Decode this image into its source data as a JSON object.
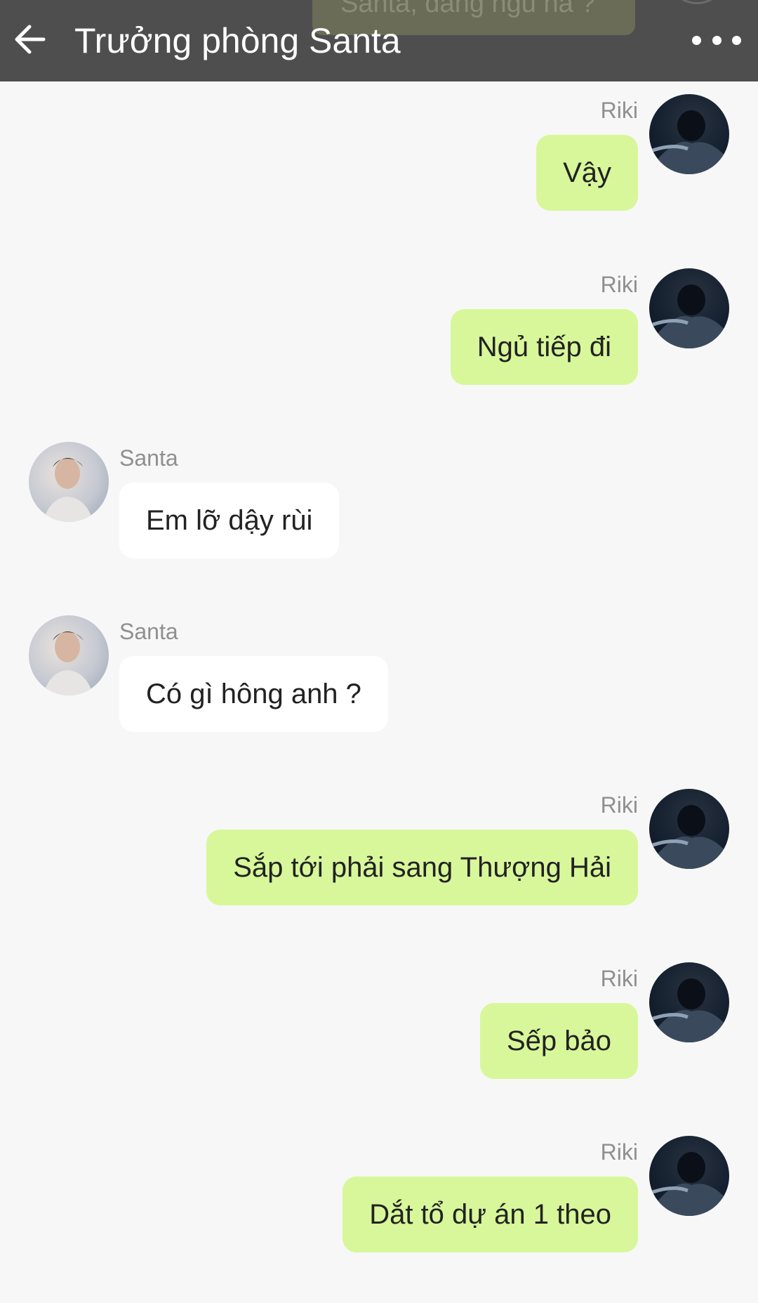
{
  "header": {
    "title": "Trưởng phòng Santa",
    "ghost_message": "Santa, đang ngủ hả ?"
  },
  "messages": [
    {
      "sender": "Riki",
      "side": "right",
      "text": "Vậy"
    },
    {
      "sender": "Riki",
      "side": "right",
      "text": "Ngủ tiếp đi"
    },
    {
      "sender": "Santa",
      "side": "left",
      "text": "Em lỡ dậy rùi"
    },
    {
      "sender": "Santa",
      "side": "left",
      "text": "Có gì hông anh ?"
    },
    {
      "sender": "Riki",
      "side": "right",
      "text": "Sắp tới phải sang Thượng Hải"
    },
    {
      "sender": "Riki",
      "side": "right",
      "text": "Sếp bảo"
    },
    {
      "sender": "Riki",
      "side": "right",
      "text": "Dắt tổ dự án 1 theo"
    }
  ],
  "colors": {
    "header_bg": "#4e4e4e",
    "page_bg": "#f7f7f7",
    "own_bubble": "#d8f79a",
    "other_bubble": "#ffffff",
    "sender_name": "#8f8f8f"
  },
  "icons": {
    "back": "arrow-left-icon",
    "more": "more-dots-icon"
  }
}
